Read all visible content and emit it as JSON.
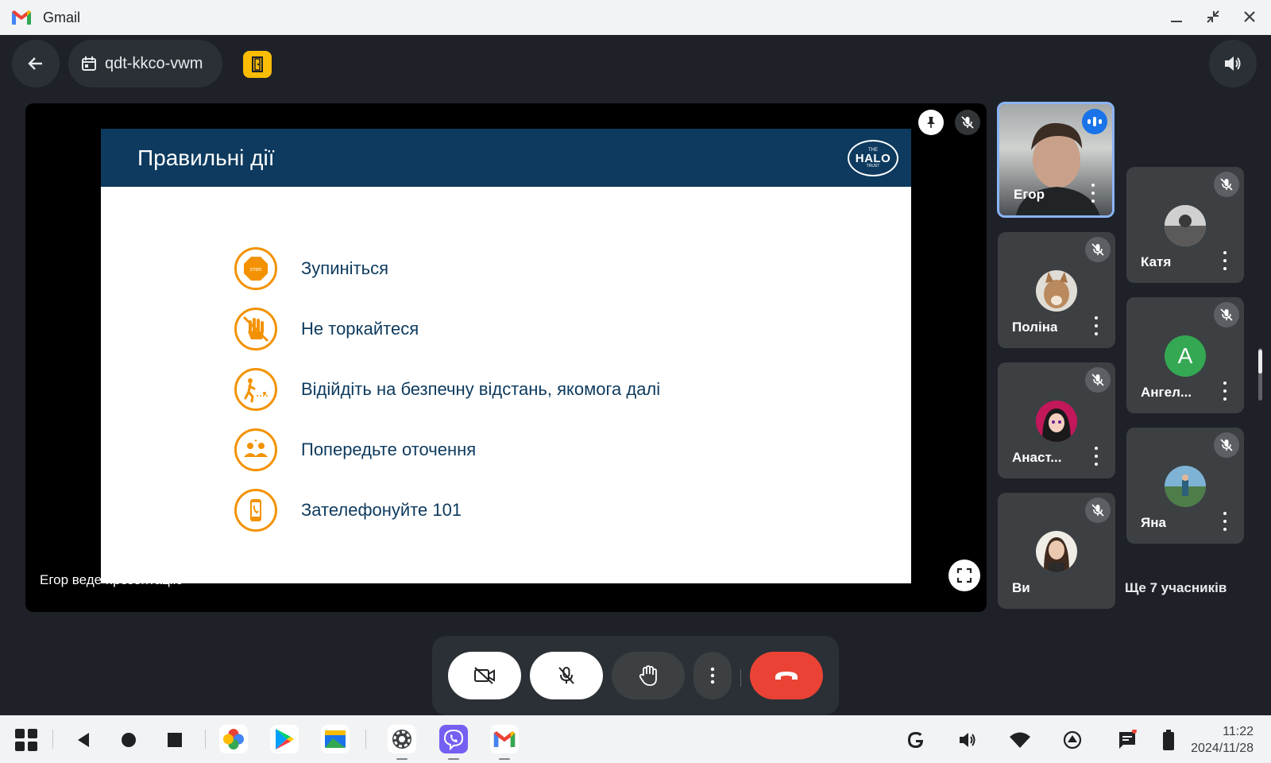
{
  "window": {
    "title": "Gmail"
  },
  "meeting": {
    "code": "qdt-kkco-vwm"
  },
  "presentation": {
    "slide_title": "Правильні дії",
    "logo": {
      "top": "THE",
      "main": "HALO",
      "bottom": "TRUST"
    },
    "actions": [
      {
        "icon": "stop-sign-icon",
        "text": "Зупиніться",
        "icon_text": "стоп"
      },
      {
        "icon": "no-touch-hand-icon",
        "text": "Не торкайтеся"
      },
      {
        "icon": "walk-away-icon",
        "text": "Відійдіть на безпечну відстань, якомога далі"
      },
      {
        "icon": "warn-people-icon",
        "text": "Попередьте оточення"
      },
      {
        "icon": "phone-icon",
        "text": "Зателефонуйте 101"
      }
    ],
    "presenter_label": "Егор веде презентацію"
  },
  "participants": [
    {
      "name": "Егор",
      "speaking": true,
      "avatar": "video"
    },
    {
      "name": "Катя",
      "muted": true,
      "avatar": "photo-bw"
    },
    {
      "name": "Поліна",
      "muted": true,
      "avatar": "photo-cat"
    },
    {
      "name": "Ангел...",
      "muted": true,
      "avatar": "letter",
      "avatar_letter": "A",
      "avatar_color": "#34a853"
    },
    {
      "name": "Анаст...",
      "muted": true,
      "avatar": "photo-anime"
    },
    {
      "name": "Яна",
      "muted": true,
      "avatar": "photo-field"
    },
    {
      "name": "Ви",
      "muted": true,
      "avatar": "photo-woman"
    }
  ],
  "more_participants": "Ще 7 учасників",
  "colors": {
    "accent": "#8ab4f8",
    "hangup": "#ea4335",
    "slide_header": "#0d3a5e",
    "slide_icon": "#f39200"
  },
  "taskbar": {
    "apps": [
      "photos-icon",
      "play-store-icon",
      "slides-icon",
      "settings-icon",
      "viber-icon",
      "gmail-icon"
    ],
    "time": "11:22",
    "date": "2024/11/28"
  }
}
